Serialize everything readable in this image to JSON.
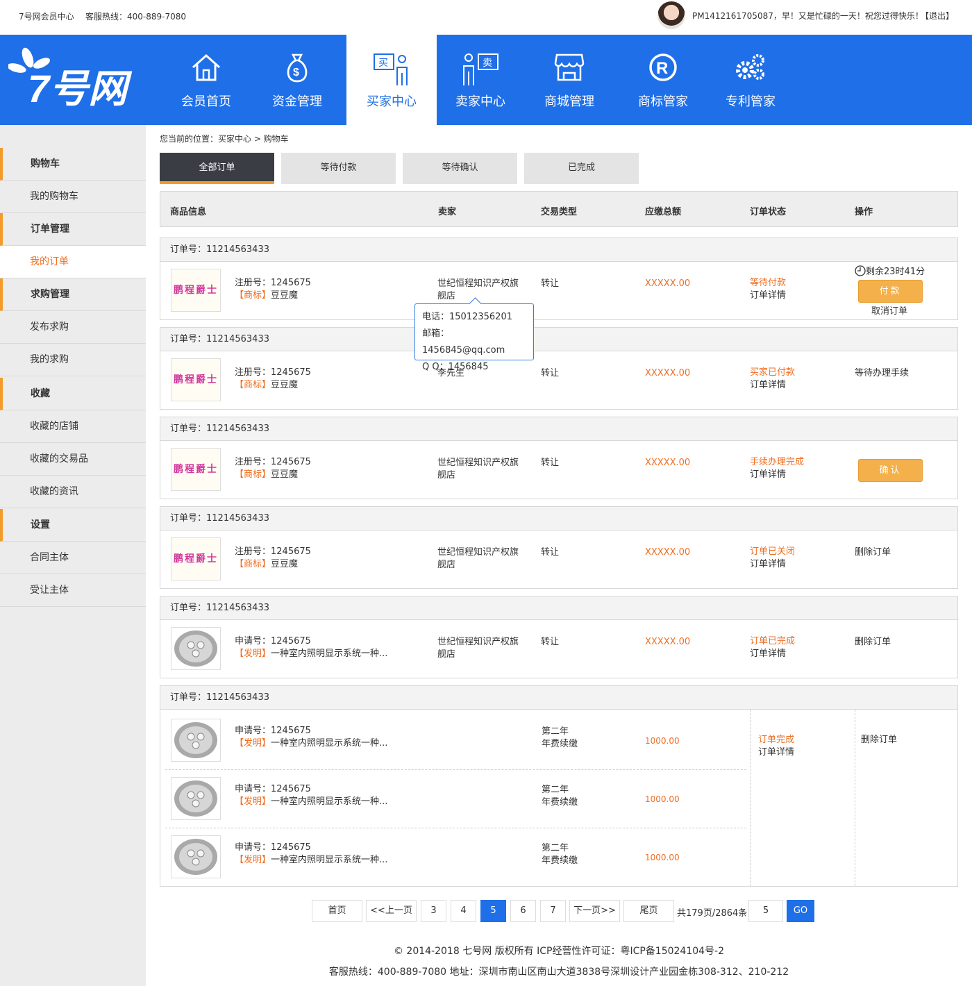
{
  "topbar": {
    "site": "7号网会员中心",
    "hotline": "客服热线：400-889-7080",
    "greeting": "PM1412161705087，早！又是忙碌的一天！祝您过得快乐！",
    "logout": "【退出】"
  },
  "logo": "7号网",
  "nav": [
    {
      "label": "会员首页",
      "icon": "home-icon"
    },
    {
      "label": "资金管理",
      "icon": "money-bag-icon"
    },
    {
      "label": "买家中心",
      "icon": "buyer-icon"
    },
    {
      "label": "卖家中心",
      "icon": "seller-icon"
    },
    {
      "label": "商城管理",
      "icon": "store-icon"
    },
    {
      "label": "商标管家",
      "icon": "registered-icon"
    },
    {
      "label": "专利管家",
      "icon": "gears-icon"
    }
  ],
  "nav_buyer_sign": "买",
  "nav_seller_sign": "卖",
  "sidebar": [
    {
      "label": "购物车",
      "group": true
    },
    {
      "label": "我的购物车"
    },
    {
      "label": "订单管理",
      "group": true
    },
    {
      "label": "我的订单",
      "selected": true
    },
    {
      "label": "求购管理",
      "group": true
    },
    {
      "label": "发布求购"
    },
    {
      "label": "我的求购"
    },
    {
      "label": "收藏",
      "group": true
    },
    {
      "label": "收藏的店铺"
    },
    {
      "label": "收藏的交易品"
    },
    {
      "label": "收藏的资讯"
    },
    {
      "label": "设置",
      "group": true
    },
    {
      "label": "合同主体"
    },
    {
      "label": "受让主体"
    }
  ],
  "breadcrumb": "您当前的位置：买家中心 >  购物车",
  "tabs": [
    "全部订单",
    "等待付款",
    "等待确认",
    "已完成"
  ],
  "table_headers": [
    "商品信息",
    "卖家",
    "交易类型",
    "应缴总额",
    "订单状态",
    "操作"
  ],
  "trademark_text": "鹏程爵士",
  "orders": [
    {
      "order_no": "订单号：11214563433",
      "reg": "注册号：1245675",
      "tag": "【商标】",
      "name": "豆豆魔",
      "seller": "世纪恒程知识产权旗舰店",
      "type": "转让",
      "amount": "XXXXX.00",
      "status": "等待付款",
      "detail": "订单详情",
      "countdown": "剩余23时41分",
      "btn": "付款",
      "op2": "取消订单"
    },
    {
      "order_no": "订单号：11214563433",
      "reg": "注册号：1245675",
      "tag": "【商标】",
      "name": "豆豆魔",
      "seller": "李先生",
      "type": "转让",
      "amount": "XXXXX.00",
      "status": "买家已付款",
      "detail": "订单详情",
      "op": "等待办理手续"
    },
    {
      "order_no": "订单号：11214563433",
      "reg": "注册号：1245675",
      "tag": "【商标】",
      "name": "豆豆魔",
      "seller": "世纪恒程知识产权旗舰店",
      "type": "转让",
      "amount": "XXXXX.00",
      "status": "手续办理完成",
      "detail": "订单详情",
      "btn": "确认"
    },
    {
      "order_no": "订单号：11214563433",
      "reg": "注册号：1245675",
      "tag": "【商标】",
      "name": "豆豆魔",
      "seller": "世纪恒程知识产权旗舰店",
      "type": "转让",
      "amount": "XXXXX.00",
      "status": "订单已关闭",
      "detail": "订单详情",
      "op": "删除订单"
    },
    {
      "order_no": "订单号：11214563433",
      "reg": "申请号：1245675",
      "tag": "【发明】",
      "name": "一种室内照明显示系统一种...",
      "seller": "世纪恒程知识产权旗舰店",
      "type": "转让",
      "amount": "XXXXX.00",
      "status": "订单已完成",
      "detail": "订单详情",
      "op": "删除订单"
    }
  ],
  "multi_order": {
    "order_no": "订单号：11214563433",
    "items": [
      {
        "reg": "申请号：1245675",
        "tag": "【发明】",
        "name": "一种室内照明显示系统一种...",
        "type1": "第二年",
        "type2": "年费续缴",
        "amount": "1000.00"
      },
      {
        "reg": "申请号：1245675",
        "tag": "【发明】",
        "name": "一种室内照明显示系统一种...",
        "type1": "第二年",
        "type2": "年费续缴",
        "amount": "1000.00"
      },
      {
        "reg": "申请号：1245675",
        "tag": "【发明】",
        "name": "一种室内照明显示系统一种...",
        "type1": "第二年",
        "type2": "年费续缴",
        "amount": "1000.00"
      }
    ],
    "status": "订单完成",
    "detail": "订单详情",
    "op": "删除订单"
  },
  "tooltip": {
    "phone": "电话：15012356201",
    "email": "邮箱：1456845@qq.com",
    "qq": "Q Q：1456845"
  },
  "pager": {
    "first": "首页",
    "prev": "<<上一页",
    "pages": [
      "3",
      "4",
      "5",
      "6",
      "7"
    ],
    "current": "5",
    "next": "下一页>>",
    "last": "尾页",
    "summary": "共179页/2864条",
    "jump_value": "5",
    "go": "GO"
  },
  "footer": {
    "copyright": "© 2014-2018 七号网 版权所有 ICP经营性许可证：粤ICP备15024104号-2",
    "contact": "客服热线：400-889-7080  地址：深圳市南山区南山大道3838号深圳设计产业园金栋308-312、210-212"
  },
  "colors": {
    "brand": "#1f6fe8",
    "accent": "#f39c2b",
    "status": "#f06d20"
  }
}
